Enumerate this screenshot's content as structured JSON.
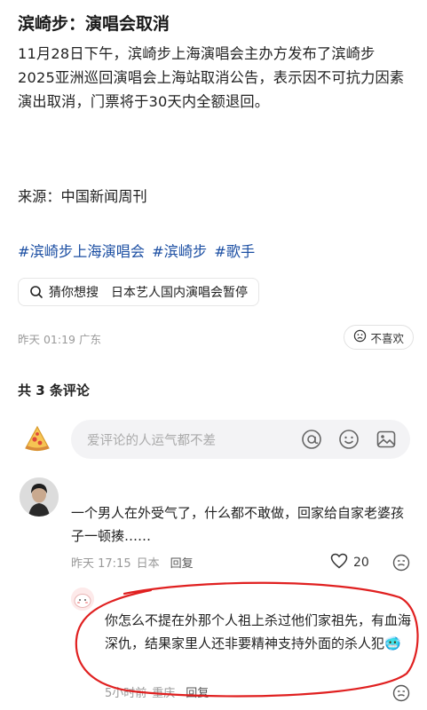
{
  "post": {
    "title": "滨崎步：演唱会取消",
    "body": "11月28日下午，滨崎步上海演唱会主办方发布了滨崎步2025亚洲巡回演唱会上海站取消公告，表示因不可抗力因素演出取消，门票将于30天内全额退回。",
    "source": "来源：中国新闻周刊",
    "tags": [
      "#滨崎步上海演唱会",
      "#滨崎步",
      "#歌手"
    ],
    "search_label": "猜你想搜",
    "search_query": "日本艺人国内演唱会暂停",
    "time": "昨天 01:19",
    "location": "广东",
    "dislike_label": "不喜欢"
  },
  "comments": {
    "header": "共 3 条评论",
    "input_placeholder": "爱评论的人运气都不差",
    "icons": [
      "at-icon",
      "emoji-icon",
      "image-icon"
    ],
    "items": [
      {
        "text": "一个男人在外受气了，什么都不敢做，回家给自家老婆孩子一顿揍……",
        "time": "昨天 17:15",
        "location": "日本",
        "reply_label": "回复",
        "likes": "20"
      },
      {
        "text": "你怎么不提在外那个人祖上杀过他们家祖先，有血海深仇，结果家里人还非要精神支持外面的杀人犯🥶",
        "time": "5小时前",
        "location": "重庆",
        "reply_label": "回复"
      }
    ]
  },
  "colors": {
    "tag": "#1c4fa3",
    "annotation": "#e02020",
    "muted": "#999999"
  }
}
